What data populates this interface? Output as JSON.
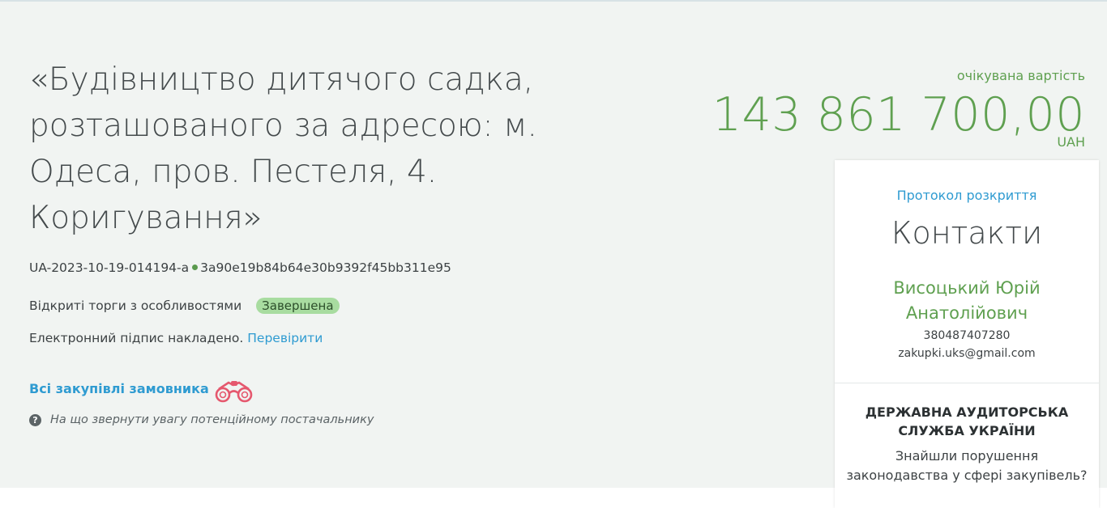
{
  "tender": {
    "title": "«Будівництво дитячого садка, розташованого за адресою: м. Одеса, пров. Пестеля, 4. Коригування»",
    "id": "UA-2023-10-19-014194-a",
    "hash": "3a90e19b84b64e30b9392f45bb311e95",
    "procedure": "Відкриті торги з особливостями",
    "status": "Завершена",
    "signature_text": "Електронний підпис накладено.",
    "signature_link": "Перевірити",
    "all_purchases_link": "Всі закупівлі замовника",
    "hint_text": "На що звернути увагу потенційному постачальнику"
  },
  "value": {
    "label": "очікувана вартість",
    "amount": "143 861 700,00",
    "currency": "UAH"
  },
  "sidebar": {
    "protocol_link": "Протокол розкриття",
    "contacts_heading": "Контакти",
    "contact_name": "Висоцький Юрій Анатолійович",
    "contact_phone": "380487407280",
    "contact_email": "zakupki.uks@gmail.com",
    "audit_title": "ДЕРЖАВНА АУДИТОРСЬКА СЛУЖБА УКРАЇНИ",
    "audit_question": "Знайшли порушення законодавства у сфері закупівель?"
  },
  "icons": {
    "binoculars": "binoculars-icon",
    "help": "question-circle-icon"
  },
  "colors": {
    "accent_green": "#5fa050",
    "link_blue": "#2f9bd1",
    "status_badge_bg": "#a8dca0",
    "binoculars": "#e5586e"
  }
}
